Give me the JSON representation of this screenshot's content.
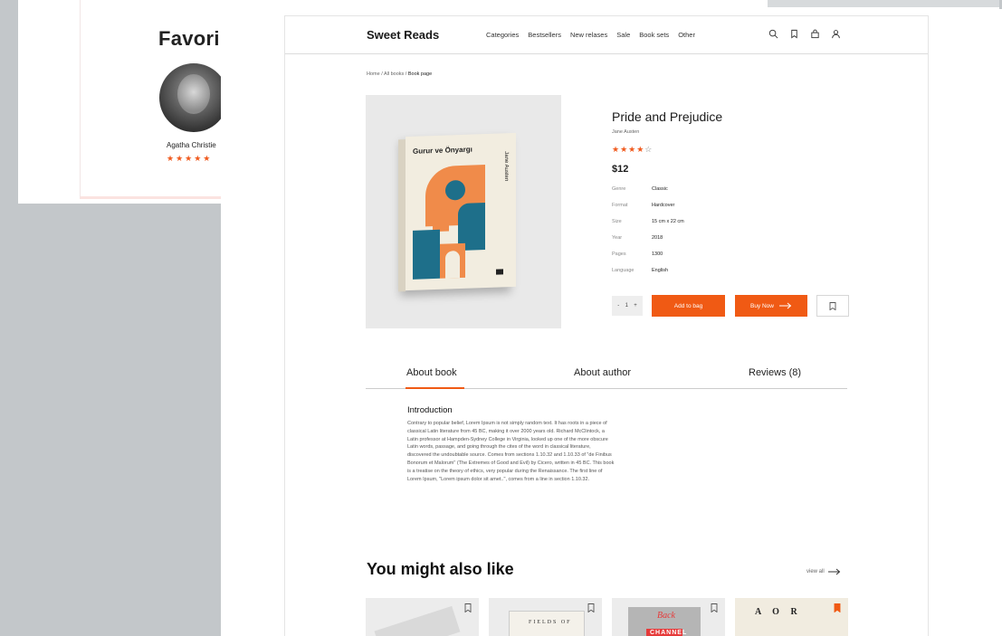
{
  "background": {
    "favorites_title": "Favori",
    "author_name": "Agatha Christie",
    "author_stars": "★★★★★"
  },
  "nav": {
    "logo": "Sweet Reads",
    "links": [
      "Categories",
      "Bestsellers",
      "New relases",
      "Sale",
      "Book sets",
      "Other"
    ],
    "icons": [
      "search-icon",
      "bookmark-icon",
      "bag-icon",
      "user-icon"
    ]
  },
  "breadcrumb": {
    "path": "Home / All books / ",
    "current": "Book page"
  },
  "cover": {
    "title": "Gurur ve Önyargı",
    "author": "Jane Austen"
  },
  "product": {
    "title": "Pride and Prejudice",
    "author": "Jane Austen",
    "rating_filled": "★★★★",
    "rating_empty": "☆",
    "rating_value": 4,
    "rating_max": 5,
    "price": "$12",
    "specs": [
      {
        "key": "Genre",
        "value": "Classic"
      },
      {
        "key": "Format",
        "value": "Hardcover"
      },
      {
        "key": "Size",
        "value": "15 cm x 22 cm"
      },
      {
        "key": "Year",
        "value": "2018"
      },
      {
        "key": "Pages",
        "value": "1300"
      },
      {
        "key": "Language",
        "value": "English"
      }
    ],
    "qty_minus": "-",
    "qty_value": "1",
    "qty_plus": "+",
    "add_to_bag": "Add to bag",
    "buy_now": "Buy Now"
  },
  "tabs": {
    "about_book": "About book",
    "about_author": "About author",
    "reviews": "Reviews (8)"
  },
  "intro": {
    "heading": "Introduction",
    "body": "Contrary to popular belief, Lorem Ipsum is not simply random text. It has roots in a piece of classical Latin literature from 45 BC, making it over 2000 years old. Richard McClintock, a Latin professor at Hampden-Sydney College in Virginia, looked up one of the more obscure Latin words, passage, and going through the cites of the word in classical literature, discovered the undoubtable source. Comes from sections 1.10.32 and 1.10.33 of \"de Finibus Bonorum et Malorum\" (The Extremes of Good and Evil) by Cicero, written in 45 BC. This book is a treatise on the theory of ethics, very popular during the Renaissance. The first line of Lorem Ipsum, \"Lorem ipsum dolor sit amet..\", comes from a line in section 1.10.32."
  },
  "recommend": {
    "heading": "You might also like",
    "view_all": "view all",
    "items": [
      {
        "cover_text": ""
      },
      {
        "cover_text": "FIELDS OF"
      },
      {
        "cover_text": "Back",
        "cover_text2": "CHANNEL"
      },
      {
        "cover_text": "A O R"
      }
    ]
  },
  "colors": {
    "accent": "#f05a14",
    "star": "#f05a1e"
  }
}
